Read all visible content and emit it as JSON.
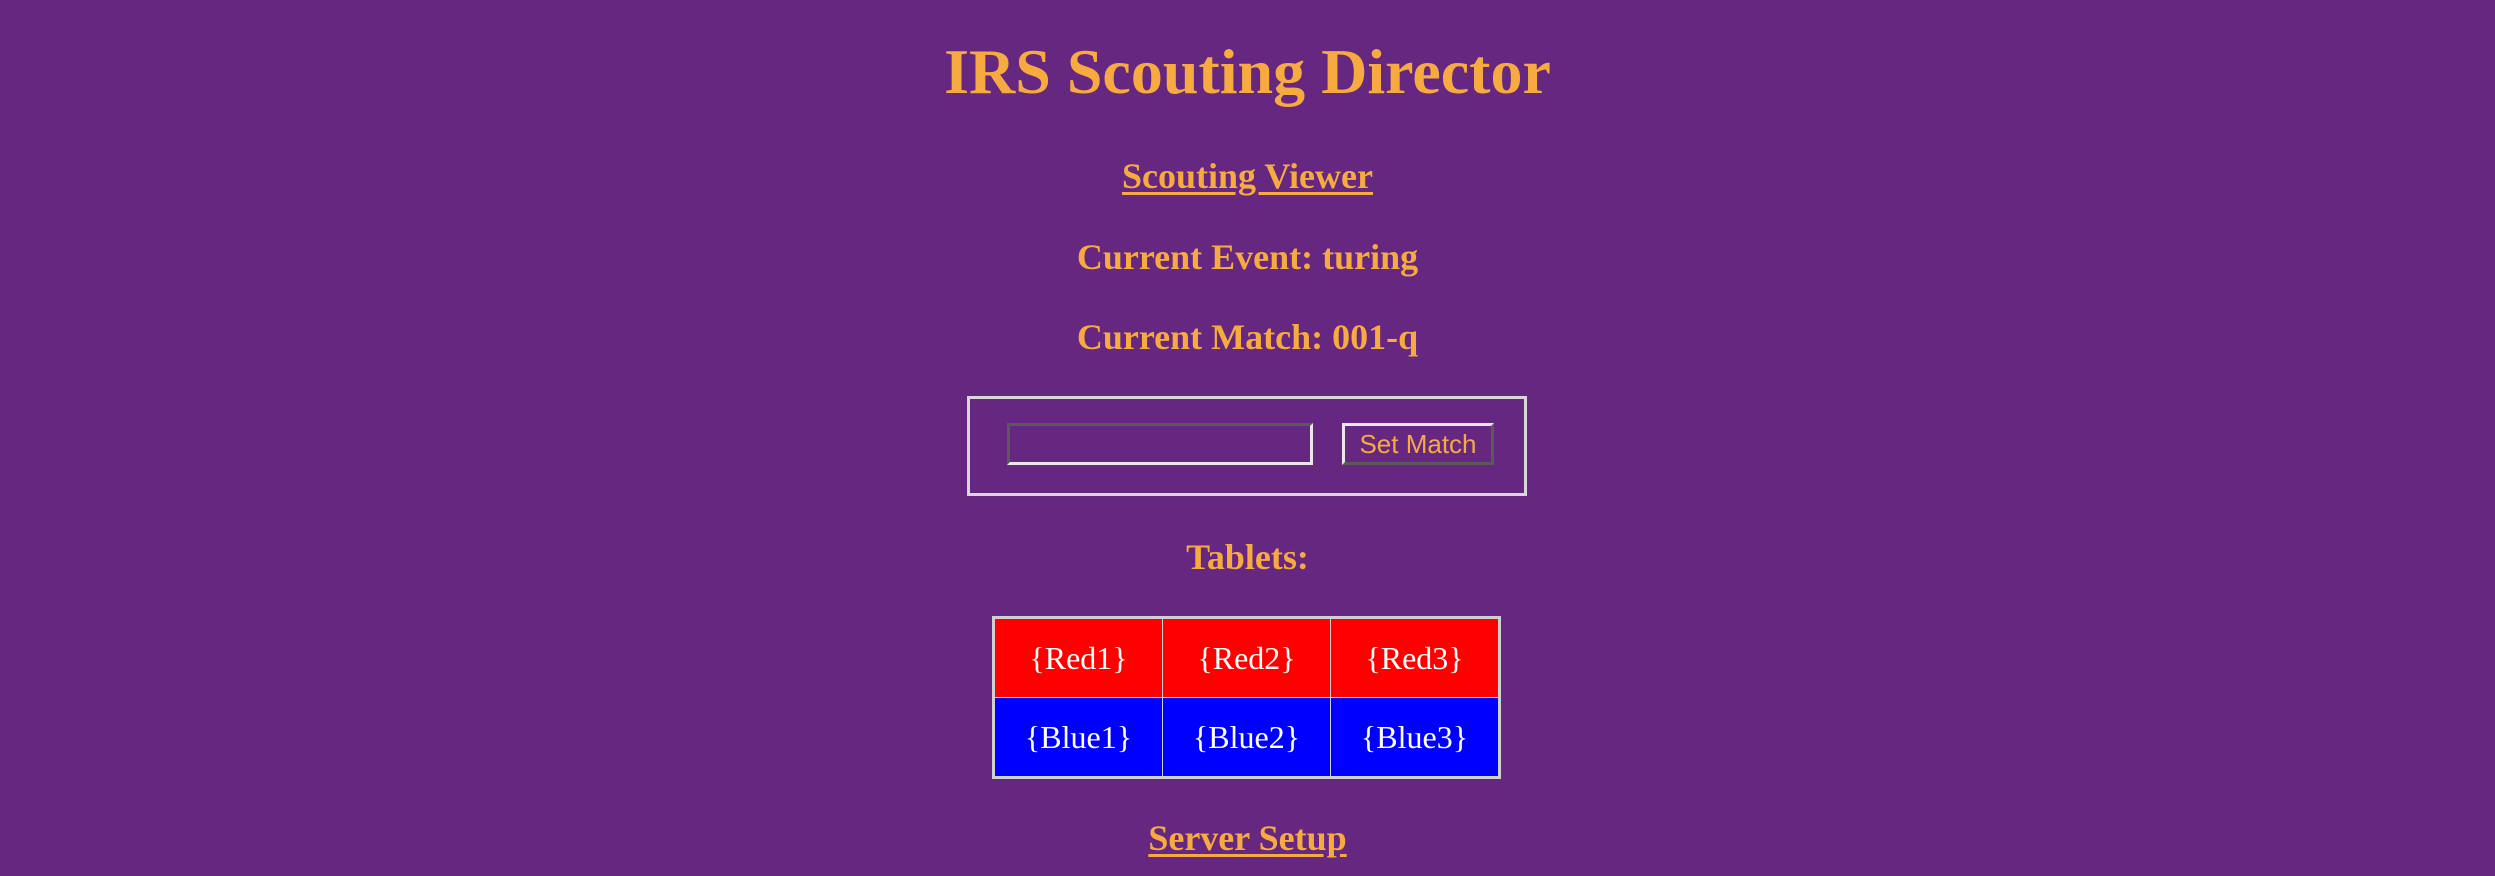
{
  "page": {
    "title": "IRS Scouting Director"
  },
  "nav": {
    "viewer_link": "Scouting Viewer",
    "setup_link": "Server Setup"
  },
  "status": {
    "event": "Current Event: turing",
    "match": "Current Match: 001-q"
  },
  "match_form": {
    "input_value": "",
    "button_label": "Set Match"
  },
  "tablets": {
    "heading": "Tablets:",
    "red": [
      "{Red1}",
      "{Red2}",
      "{Red3}"
    ],
    "blue": [
      "{Blue1}",
      "{Blue2}",
      "{Blue3}"
    ]
  },
  "colors": {
    "background": "#662780",
    "text": "#F7AA3F",
    "red_alliance": "#FF0000",
    "blue_alliance": "#0000FF"
  }
}
